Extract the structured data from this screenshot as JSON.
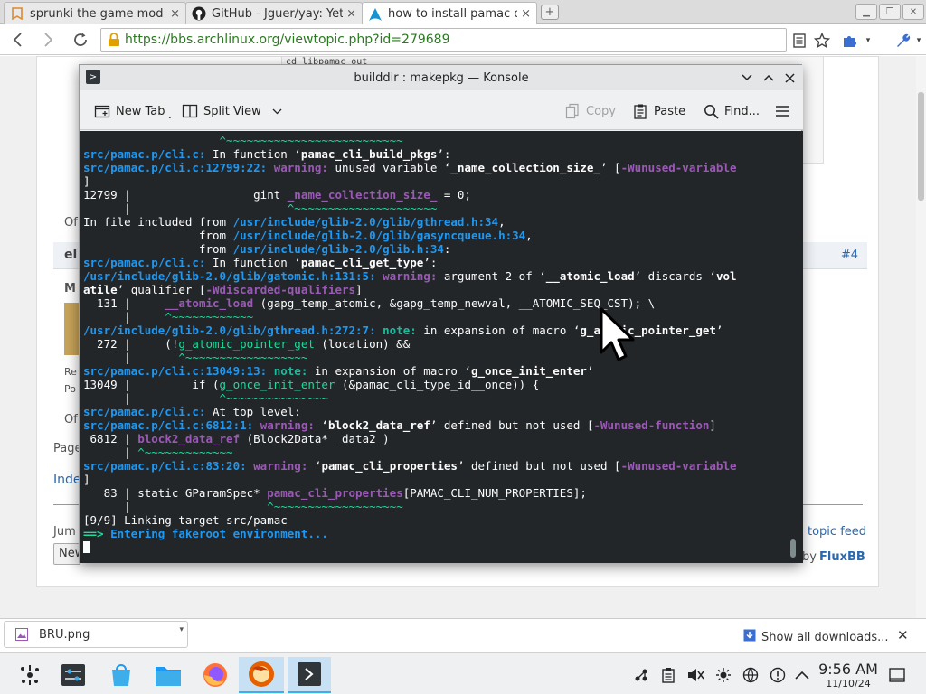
{
  "browser": {
    "tabs": [
      {
        "label": "sprunki the game mod",
        "icon": "bookmark-icon",
        "active": false
      },
      {
        "label": "GitHub - Jguer/yay: Yet",
        "icon": "github-icon",
        "active": false
      },
      {
        "label": "how to install pamac or",
        "icon": "arch-icon",
        "active": true
      }
    ],
    "new_tab_glyph": "+",
    "url": "https://bbs.archlinux.org/viewtopic.php?id=279689",
    "close_glyph": "×"
  },
  "page_fragments": {
    "code_snip": "cd libpamac_out",
    "op1": "Of",
    "post_author_snip": "el",
    "post_num": "#4",
    "member_snip": "M",
    "reg_snip": "Re",
    "posts_snip": "Po",
    "op2": "Of",
    "pages_snip": "Page",
    "index_snip": "Inde",
    "jump_snip": "Jum",
    "new_snip": "New",
    "topic_feed": "topic feed",
    "powered_by": "by",
    "fluxbb": "FluxBB"
  },
  "konsole": {
    "title": "builddir : makepkg — Konsole",
    "toolbar": {
      "new_tab": "New Tab",
      "split_view": "Split View",
      "copy": "Copy",
      "paste": "Paste",
      "find": "Find..."
    },
    "lines": [
      [
        {
          "t": "                    ^~~~~~~~~~~~~~~~~~~~~~~~~~~",
          "c": "c-grn"
        }
      ],
      [
        {
          "t": "src/pamac.p/cli.c:",
          "c": "c-blue c-bold"
        },
        {
          "t": " In function ‘"
        },
        {
          "t": "pamac_cli_build_pkgs",
          "c": "c-bold"
        },
        {
          "t": "’:"
        }
      ],
      [
        {
          "t": "src/pamac.p/cli.c:12799:22:",
          "c": "c-blue c-bold"
        },
        {
          "t": " "
        },
        {
          "t": "warning:",
          "c": "c-mag c-bold"
        },
        {
          "t": " unused variable ‘"
        },
        {
          "t": "_name_collection_size_",
          "c": "c-bold"
        },
        {
          "t": "’ ["
        },
        {
          "t": "-Wunused-variable",
          "c": "c-mag c-bold"
        }
      ],
      [
        {
          "t": "]"
        }
      ],
      [
        {
          "t": "12799 |                  gint "
        },
        {
          "t": "_name_collection_size_",
          "c": "c-mag c-bold"
        },
        {
          "t": " = 0;"
        }
      ],
      [
        {
          "t": "      |                       "
        },
        {
          "t": "^~~~~~~~~~~~~~~~~~~~~~",
          "c": "c-grn"
        }
      ],
      [
        {
          "t": "In file included from "
        },
        {
          "t": "/usr/include/glib-2.0/glib/gthread.h:34",
          "c": "c-blue c-bold"
        },
        {
          "t": ","
        }
      ],
      [
        {
          "t": "                 from "
        },
        {
          "t": "/usr/include/glib-2.0/glib/gasyncqueue.h:34",
          "c": "c-blue c-bold"
        },
        {
          "t": ","
        }
      ],
      [
        {
          "t": "                 from "
        },
        {
          "t": "/usr/include/glib-2.0/glib.h:34",
          "c": "c-blue c-bold"
        },
        {
          "t": ":"
        }
      ],
      [
        {
          "t": "src/pamac.p/cli.c:",
          "c": "c-blue c-bold"
        },
        {
          "t": " In function ‘"
        },
        {
          "t": "pamac_cli_get_type",
          "c": "c-bold"
        },
        {
          "t": "’:"
        }
      ],
      [
        {
          "t": "/usr/include/glib-2.0/glib/gatomic.h:131:5:",
          "c": "c-blue c-bold"
        },
        {
          "t": " "
        },
        {
          "t": "warning:",
          "c": "c-mag c-bold"
        },
        {
          "t": " argument 2 of ‘"
        },
        {
          "t": "__atomic_load",
          "c": "c-bold"
        },
        {
          "t": "’ discards ‘"
        },
        {
          "t": "vol",
          "c": "c-bold"
        }
      ],
      [
        {
          "t": "atile",
          "c": "c-bold"
        },
        {
          "t": "’ qualifier ["
        },
        {
          "t": "-Wdiscarded-qualifiers",
          "c": "c-mag c-bold"
        },
        {
          "t": "]"
        }
      ],
      [
        {
          "t": "  131 |     "
        },
        {
          "t": "__atomic_load",
          "c": "c-mag c-bold"
        },
        {
          "t": " (gapg_temp_atomic, &gapg_temp_newval, __ATOMIC_SEQ_CST); \\"
        }
      ],
      [
        {
          "t": "      |     "
        },
        {
          "t": "^~~~~~~~~~~~~",
          "c": "c-grn"
        }
      ],
      [
        {
          "t": "/usr/include/glib-2.0/glib/gthread.h:272:7:",
          "c": "c-blue c-bold"
        },
        {
          "t": " "
        },
        {
          "t": "note:",
          "c": "c-cyan c-bold"
        },
        {
          "t": " in expansion of macro ‘"
        },
        {
          "t": "g_atomic_pointer_get",
          "c": "c-bold"
        },
        {
          "t": "’"
        }
      ],
      [
        {
          "t": "  272 |     (!"
        },
        {
          "t": "g_atomic_pointer_get",
          "c": "c-grn"
        },
        {
          "t": " (location) &&                            \\"
        }
      ],
      [
        {
          "t": "      |       "
        },
        {
          "t": "^~~~~~~~~~~~~~~~~~~",
          "c": "c-grn"
        }
      ],
      [
        {
          "t": "src/pamac.p/cli.c:13049:13:",
          "c": "c-blue c-bold"
        },
        {
          "t": " "
        },
        {
          "t": "note:",
          "c": "c-cyan c-bold"
        },
        {
          "t": " in expansion of macro ‘"
        },
        {
          "t": "g_once_init_enter",
          "c": "c-bold"
        },
        {
          "t": "’"
        }
      ],
      [
        {
          "t": "13049 |         if ("
        },
        {
          "t": "g_once_init_enter",
          "c": "c-grn"
        },
        {
          "t": " (&pamac_cli_type_id__once)) {"
        }
      ],
      [
        {
          "t": "      |             "
        },
        {
          "t": "^~~~~~~~~~~~~~~~",
          "c": "c-grn"
        }
      ],
      [
        {
          "t": "src/pamac.p/cli.c:",
          "c": "c-blue c-bold"
        },
        {
          "t": " At top level:"
        }
      ],
      [
        {
          "t": "src/pamac.p/cli.c:6812:1:",
          "c": "c-blue c-bold"
        },
        {
          "t": " "
        },
        {
          "t": "warning:",
          "c": "c-mag c-bold"
        },
        {
          "t": " ‘"
        },
        {
          "t": "block2_data_ref",
          "c": "c-bold"
        },
        {
          "t": "’ defined but not used ["
        },
        {
          "t": "-Wunused-function",
          "c": "c-mag c-bold"
        },
        {
          "t": "]"
        }
      ],
      [
        {
          "t": " 6812 | "
        },
        {
          "t": "block2_data_ref",
          "c": "c-mag c-bold"
        },
        {
          "t": " (Block2Data* _data2_)"
        }
      ],
      [
        {
          "t": "      | "
        },
        {
          "t": "^~~~~~~~~~~~~~",
          "c": "c-grn"
        }
      ],
      [
        {
          "t": "src/pamac.p/cli.c:83:20:",
          "c": "c-blue c-bold"
        },
        {
          "t": " "
        },
        {
          "t": "warning:",
          "c": "c-mag c-bold"
        },
        {
          "t": " ‘"
        },
        {
          "t": "pamac_cli_properties",
          "c": "c-bold"
        },
        {
          "t": "’ defined but not used ["
        },
        {
          "t": "-Wunused-variable",
          "c": "c-mag c-bold"
        }
      ],
      [
        {
          "t": "]"
        }
      ],
      [
        {
          "t": "   83 | static GParamSpec* "
        },
        {
          "t": "pamac_cli_properties",
          "c": "c-mag c-bold"
        },
        {
          "t": "[PAMAC_CLI_NUM_PROPERTIES];"
        }
      ],
      [
        {
          "t": "      |                    "
        },
        {
          "t": "^~~~~~~~~~~~~~~~~~~~",
          "c": "c-grn"
        }
      ],
      [
        {
          "t": "[9/9] Linking target src/pamac"
        }
      ],
      [
        {
          "t": "==>",
          "c": "c-grn c-bold"
        },
        {
          "t": " Entering fakeroot environment...",
          "c": "c-blue c-bold"
        }
      ]
    ]
  },
  "downloads": {
    "file": "BRU.png",
    "show_all": "Show all downloads...",
    "close_glyph": "✕"
  },
  "taskbar": {
    "time": "9:56 AM",
    "date": "11/10/24"
  },
  "colors": {
    "terminal_bg": "#232629",
    "path_blue": "#1d99f3",
    "warning_magenta": "#9b59b6",
    "caret_green": "#1cdc9a",
    "url_green": "#2a7a1f",
    "link_blue": "#2b68b0"
  }
}
